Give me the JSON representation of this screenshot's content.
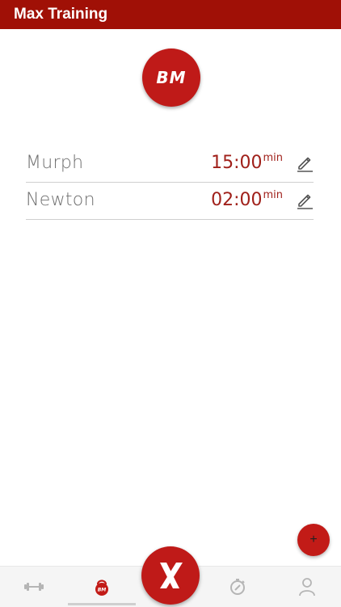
{
  "app_bar": {
    "title": "Max Training"
  },
  "logo": {
    "text": "BM"
  },
  "workouts": [
    {
      "name": "Murph",
      "time": "15:00",
      "unit": "min"
    },
    {
      "name": "Newton",
      "time": "02:00",
      "unit": "min"
    }
  ],
  "fab": {
    "label": "+"
  },
  "bottom_nav": {
    "items": [
      "dumbbell-icon",
      "kettlebell-icon",
      "crossfit-x-icon",
      "stopwatch-icon",
      "person-icon"
    ],
    "active_index": 1
  },
  "colors": {
    "primary": "#a01006",
    "accent": "#bf1a18",
    "time_text": "#a0201a",
    "name_text": "#6f6f6f"
  }
}
